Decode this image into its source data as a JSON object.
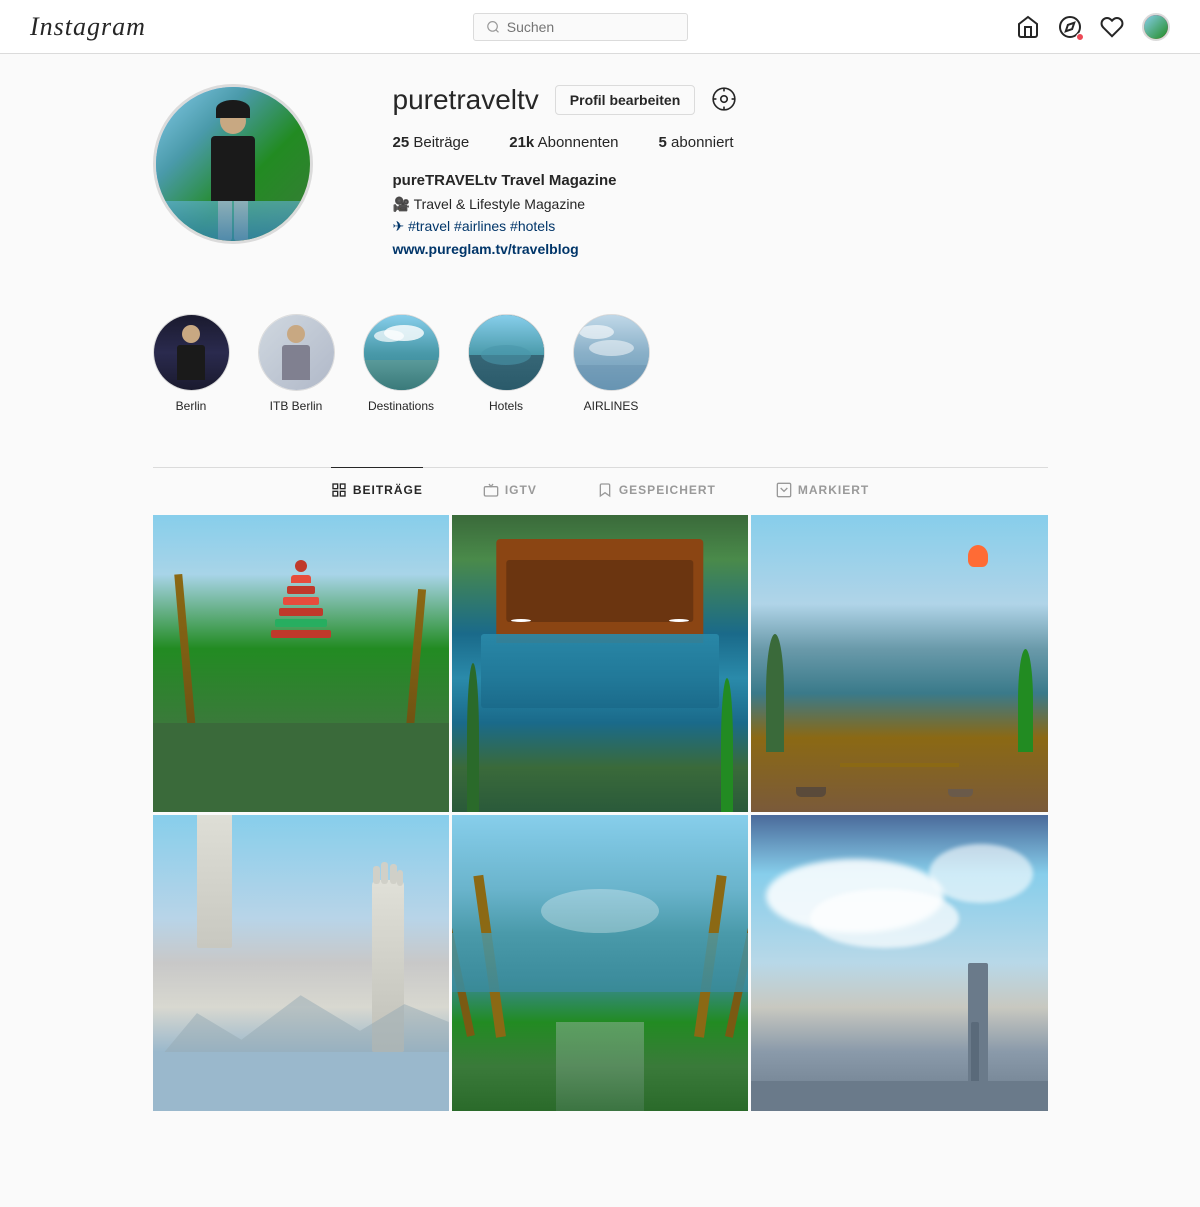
{
  "nav": {
    "logo": "Instagram",
    "search_placeholder": "Suchen",
    "icons": [
      "home",
      "compass",
      "heart",
      "profile"
    ]
  },
  "profile": {
    "username": "puretraveltv",
    "edit_button": "Profil bearbeiten",
    "stats": {
      "posts_count": "25",
      "posts_label": "Beiträge",
      "followers_count": "21k",
      "followers_label": "Abonnenten",
      "following_count": "5",
      "following_label": "abonniert"
    },
    "bio": {
      "name": "pureTRAVELtv Travel Magazine",
      "line1": "🎥 Travel & Lifestyle Magazine",
      "line2": "✈ #travel #airlines #hotels",
      "link": "www.pureglam.tv/travelblog"
    }
  },
  "highlights": [
    {
      "id": "berlin",
      "label": "Berlin",
      "bg": "hl-berlin"
    },
    {
      "id": "itb-berlin",
      "label": "ITB Berlin",
      "bg": "hl-itb"
    },
    {
      "id": "destinations",
      "label": "Destinations",
      "bg": "hl-dest"
    },
    {
      "id": "hotels",
      "label": "Hotels",
      "bg": "hl-hotels"
    },
    {
      "id": "airlines",
      "label": "AIRLINES",
      "bg": "hl-airlines"
    }
  ],
  "tabs": [
    {
      "id": "posts",
      "label": "BEITRÄGE",
      "active": true
    },
    {
      "id": "igtv",
      "label": "IGTV",
      "active": false
    },
    {
      "id": "saved",
      "label": "GESPEICHERT",
      "active": false
    },
    {
      "id": "tagged",
      "label": "MARKIERT",
      "active": false
    }
  ],
  "posts": [
    {
      "id": "post-1",
      "bg": "post-img-1"
    },
    {
      "id": "post-2",
      "bg": "post-img-2"
    },
    {
      "id": "post-3",
      "bg": "post-img-3"
    },
    {
      "id": "post-4",
      "bg": "post-img-4"
    },
    {
      "id": "post-5",
      "bg": "post-img-5"
    },
    {
      "id": "post-6",
      "bg": "post-img-6"
    }
  ]
}
